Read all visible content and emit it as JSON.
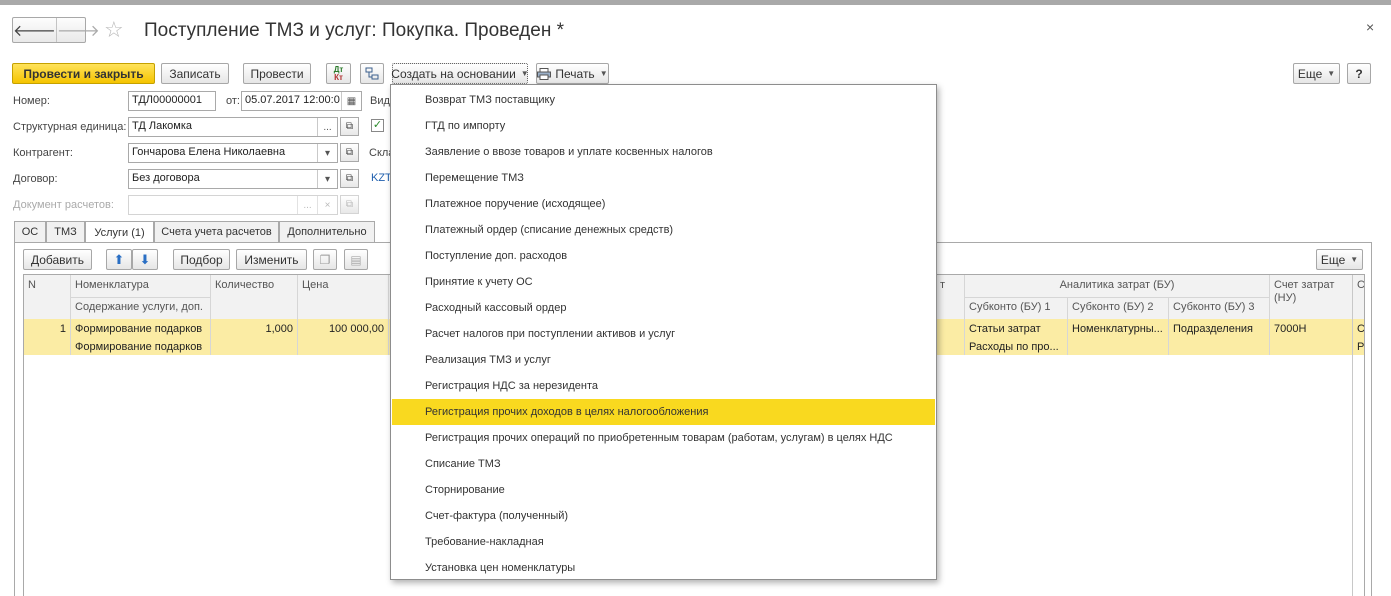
{
  "window": {
    "title": "Поступление ТМЗ и услуг: Покупка. Проведен *",
    "close": "×"
  },
  "nav": {
    "back": "🡐",
    "forward": "🡒",
    "favorite": "☆"
  },
  "toolbar": {
    "post_close": "Провести и закрыть",
    "save": "Записать",
    "post": "Провести",
    "dt_kt_top": "Дт",
    "dt_kt_bottom": "Кт",
    "create_based_on": "Создать на основании",
    "print": "Печать",
    "more": "Еще",
    "help": "?"
  },
  "form": {
    "number_label": "Номер:",
    "number_value": "ТДЛ00000001",
    "date_label": "от:",
    "date_value": "05.07.2017 12:00:0",
    "kind_label": "Вид",
    "unit_label": "Структурная единица:",
    "unit_value": "ТД Лакомка",
    "counterparty_label": "Контрагент:",
    "counterparty_value": "Гончарова Елена Николаевна",
    "warehouse_label": "Скла",
    "contract_label": "Договор:",
    "contract_value": "Без договора",
    "currency_value": "KZT",
    "settlement_doc_label": "Документ расчетов:",
    "settlement_doc_value": ""
  },
  "tabs": [
    {
      "label": "ОС"
    },
    {
      "label": "ТМЗ"
    },
    {
      "label": "Услуги (1)",
      "active": true
    },
    {
      "label": "Счета учета расчетов"
    },
    {
      "label": "Дополнительно"
    }
  ],
  "table_toolbar": {
    "add": "Добавить",
    "pick": "Подбор",
    "edit": "Изменить",
    "more": "Еще"
  },
  "table": {
    "headers": {
      "n": "N",
      "nomenclature": "Номенклатура",
      "service_content": "Содержание услуги, доп.",
      "quantity": "Количество",
      "price": "Цена",
      "hidden_tail": "т",
      "analytics_group": "Аналитика затрат (БУ)",
      "subconto1": "Субконто (БУ) 1",
      "subconto2": "Субконто (БУ) 2",
      "subconto3": "Субконто (БУ) 3",
      "cost_account_nu": "Счет затрат (НУ)",
      "last_col": "С"
    },
    "rows": [
      {
        "n": "1",
        "nomenclature": "Формирование подарков",
        "service_content": "Формирование подарков",
        "quantity": "1,000",
        "price": "100 000,00",
        "subconto1": "Статьи затрат",
        "subconto1_value": "Расходы по про...",
        "subconto2": "Номенклатурны...",
        "subconto3": "Подразделения",
        "cost_account_nu": "7000Н",
        "last_col_top": "С",
        "last_col_bottom": "Р"
      }
    ]
  },
  "create_menu": {
    "items": [
      "Возврат ТМЗ поставщику",
      "ГТД по импорту",
      "Заявление о ввозе товаров и уплате косвенных налогов",
      "Перемещение ТМЗ",
      "Платежное поручение (исходящее)",
      "Платежный ордер (списание денежных средств)",
      "Поступление доп. расходов",
      "Принятие к учету ОС",
      "Расходный кассовый ордер",
      "Расчет налогов при поступлении активов и услуг",
      "Реализация ТМЗ и услуг",
      "Регистрация НДС за нерезидента",
      "Регистрация прочих доходов в целях налогообложения",
      "Регистрация прочих операций по приобретенным товарам (работам, услугам) в целях НДС",
      "Списание ТМЗ",
      "Сторнирование",
      "Счет-фактура (полученный)",
      "Требование-накладная",
      "Установка цен номенклатуры"
    ],
    "highlighted_index": 12
  },
  "colors": {
    "primary_button": "#f5c400",
    "highlight": "#f9d91f",
    "selected_row": "#fbeca4",
    "link": "#1f5fae"
  }
}
